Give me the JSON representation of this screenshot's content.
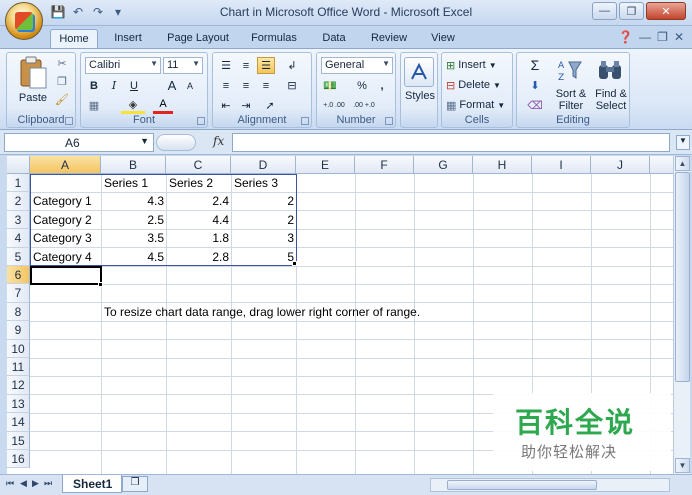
{
  "window": {
    "title": "Chart in Microsoft Office Word - Microsoft Excel"
  },
  "ribbon_tabs": [
    "Home",
    "Insert",
    "Page Layout",
    "Formulas",
    "Data",
    "Review",
    "View"
  ],
  "ribbon": {
    "clipboard": {
      "label": "Clipboard",
      "paste": "Paste"
    },
    "font": {
      "label": "Font",
      "name": "Calibri",
      "size": "11",
      "bold": "B",
      "italic": "I",
      "underline": "U",
      "grow": "A",
      "shrink": "A",
      "color_a": "A"
    },
    "alignment": {
      "label": "Alignment"
    },
    "number": {
      "label": "Number",
      "format": "General",
      "percent": "%",
      "comma": ",",
      "inc_decimal": "+.0 .00",
      "dec_decimal": ".00 +.0"
    },
    "styles": {
      "label": "Styles",
      "button": "Styles"
    },
    "cells": {
      "label": "Cells",
      "insert": "Insert",
      "delete": "Delete",
      "format": "Format"
    },
    "editing": {
      "label": "Editing",
      "sigma": "Σ",
      "sort": "Sort &",
      "filter": "Filter",
      "find": "Find &",
      "select": "Select"
    }
  },
  "formula_bar": {
    "name_box": "A6",
    "fx": "fx",
    "value": ""
  },
  "sheet": {
    "columns": [
      "A",
      "B",
      "C",
      "D",
      "E",
      "F",
      "G",
      "H",
      "I",
      "J"
    ],
    "rows": [
      "1",
      "2",
      "3",
      "4",
      "5",
      "6",
      "7",
      "8",
      "9",
      "10",
      "11",
      "12",
      "13",
      "14",
      "15",
      "16"
    ],
    "headers": [
      "Series 1",
      "Series 2",
      "Series 3"
    ],
    "data": [
      {
        "category": "Category 1",
        "s1": "4.3",
        "s2": "2.4",
        "s3": "2"
      },
      {
        "category": "Category 2",
        "s1": "2.5",
        "s2": "4.4",
        "s3": "2"
      },
      {
        "category": "Category 3",
        "s1": "3.5",
        "s2": "1.8",
        "s3": "3"
      },
      {
        "category": "Category 4",
        "s1": "4.5",
        "s2": "2.8",
        "s3": "5"
      }
    ],
    "note": "To resize chart data range, drag lower right corner of range.",
    "active_cell": "A6"
  },
  "sheet_tabs": [
    "Sheet1"
  ],
  "watermark": {
    "title": "百科全说",
    "subtitle": "助你轻松解决"
  },
  "colors": {
    "ribbon_bg": "#dbe7f7",
    "range_border": "#3a53a4",
    "header_selected": "#f4c463",
    "watermark_green": "#2ea84f"
  }
}
